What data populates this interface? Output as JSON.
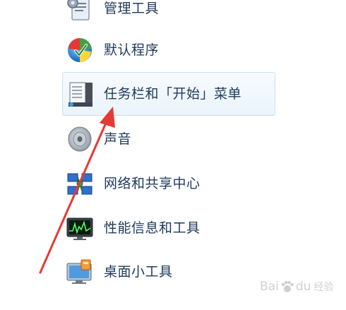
{
  "items": [
    {
      "label": "管理工具",
      "icon": "admin-tools-icon"
    },
    {
      "label": "默认程序",
      "icon": "default-programs-icon"
    },
    {
      "label": "任务栏和「开始」菜单",
      "icon": "taskbar-start-menu-icon",
      "selected": true
    },
    {
      "label": "声音",
      "icon": "sound-icon"
    },
    {
      "label": "网络和共享中心",
      "icon": "network-sharing-icon"
    },
    {
      "label": "性能信息和工具",
      "icon": "performance-icon"
    },
    {
      "label": "桌面小工具",
      "icon": "desktop-gadgets-icon"
    }
  ],
  "annotation": {
    "type": "red-arrow",
    "points_to": "任务栏和「开始」菜单",
    "color": "#e53935"
  },
  "watermark": {
    "brand": "Bai",
    "brand_suffix": "du",
    "sub": "经验"
  },
  "colors": {
    "label": "#1e395b",
    "selection_bg": "#ebf4fb",
    "selection_border": "#c9dff0"
  }
}
